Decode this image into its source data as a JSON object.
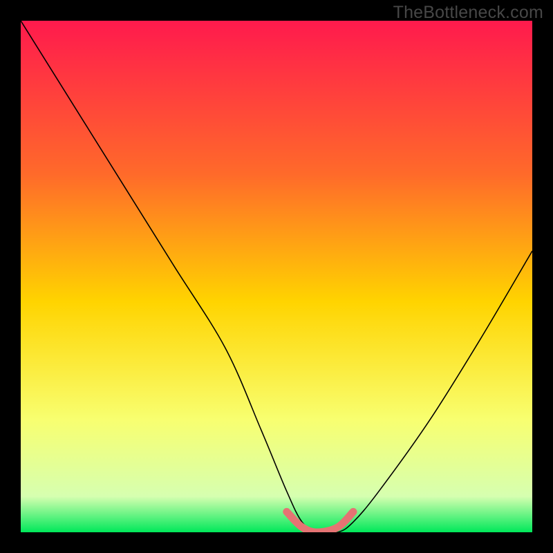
{
  "watermark": "TheBottleneck.com",
  "chart_data": {
    "type": "line",
    "title": "",
    "xlabel": "",
    "ylabel": "",
    "xlim": [
      0,
      100
    ],
    "ylim": [
      0,
      100
    ],
    "background_gradient": {
      "stops": [
        {
          "pos": 0.0,
          "color": "#ff1a4d"
        },
        {
          "pos": 0.3,
          "color": "#ff6a2a"
        },
        {
          "pos": 0.55,
          "color": "#ffd400"
        },
        {
          "pos": 0.78,
          "color": "#f8ff70"
        },
        {
          "pos": 0.93,
          "color": "#d6ffb0"
        },
        {
          "pos": 1.0,
          "color": "#00e85a"
        }
      ]
    },
    "series": [
      {
        "name": "bottleneck-curve",
        "x": [
          0,
          10,
          20,
          30,
          40,
          47,
          52,
          55,
          58,
          62,
          65,
          70,
          80,
          90,
          100
        ],
        "y": [
          100,
          84,
          68,
          52,
          36,
          20,
          8,
          2,
          0,
          0,
          2,
          8,
          22,
          38,
          55
        ],
        "color": "#000000"
      }
    ],
    "highlight": {
      "name": "flat-bottom",
      "x": [
        52,
        55,
        58,
        62,
        65
      ],
      "y": [
        4,
        1,
        0,
        1,
        4
      ],
      "color": "#e57373"
    }
  }
}
